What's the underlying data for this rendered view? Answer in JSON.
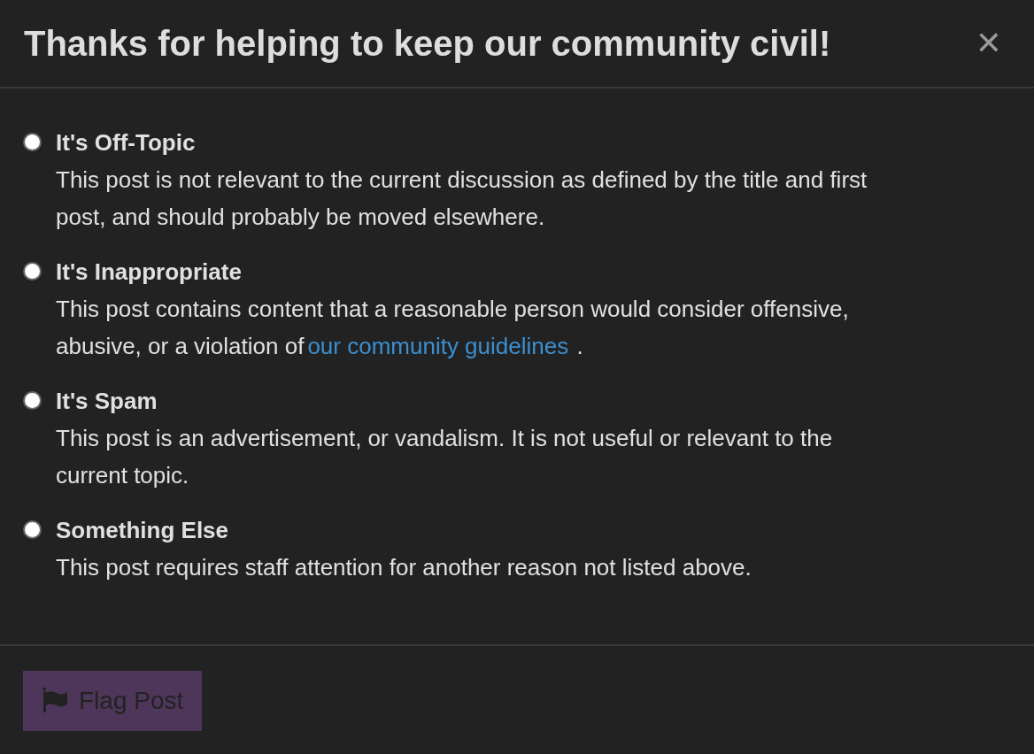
{
  "title": "Thanks for helping to keep our community civil!",
  "close": "✕",
  "options": [
    {
      "label": "It's Off-Topic",
      "selected": false,
      "description": "This post is not relevant to the current discussion as defined by the title and first post, and should probably be moved elsewhere."
    },
    {
      "label": "It's Inappropriate",
      "selected": false,
      "description": "This post contains content that a reasonable person would consider offensive, abusive, or a violation of",
      "link": "our community guidelines",
      "after": "."
    },
    {
      "label": "It's Spam",
      "selected": false,
      "description": "This post is an advertisement, or vandalism. It is not useful or relevant to the current topic."
    },
    {
      "label": "Something Else",
      "selected": false,
      "description": "This post requires staff attention for another reason not listed above."
    }
  ],
  "button": {
    "label": "Flag Post",
    "disabled": true
  }
}
